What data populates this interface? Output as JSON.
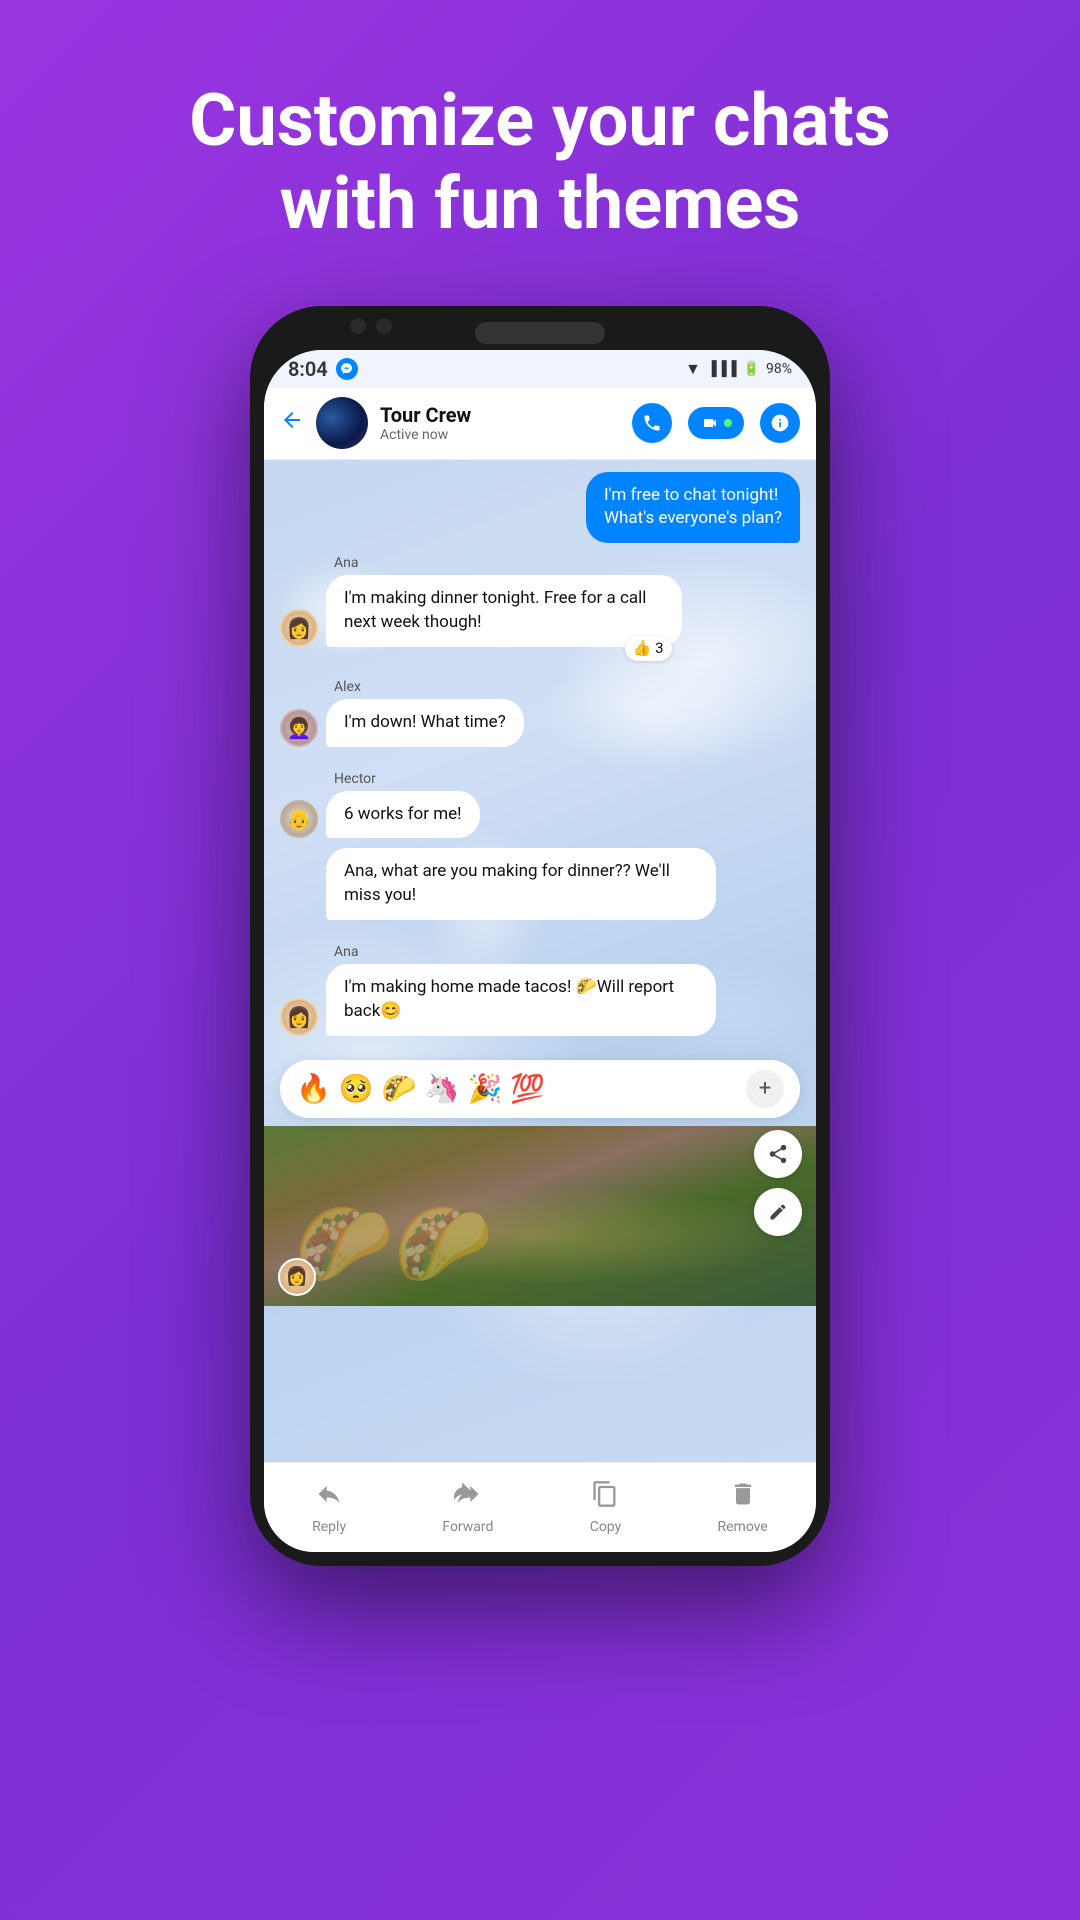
{
  "headline": {
    "line1": "Customize your chats",
    "line2": "with fun themes"
  },
  "status_bar": {
    "time": "8:04",
    "battery": "98%"
  },
  "header": {
    "group_name": "Tour Crew",
    "status": "Active now",
    "back_label": "←"
  },
  "messages": [
    {
      "id": "msg1",
      "type": "outgoing",
      "text": "I'm free to chat tonight! What's everyone's plan?"
    },
    {
      "id": "msg2",
      "type": "incoming",
      "sender": "Ana",
      "avatar": "ana",
      "text": "I'm making dinner tonight. Free for a call next week though!",
      "reaction": "👍 3"
    },
    {
      "id": "msg3",
      "type": "incoming",
      "sender": "Alex",
      "avatar": "alex",
      "text": "I'm down! What time?"
    },
    {
      "id": "msg4",
      "type": "incoming",
      "sender": "Hector",
      "avatar": "hector",
      "text": "6 works for me!"
    },
    {
      "id": "msg5",
      "type": "incoming",
      "sender": "Hector",
      "avatar": "hector",
      "text": "Ana, what are you making for dinner?? We'll miss you!"
    },
    {
      "id": "msg6",
      "type": "incoming",
      "sender": "Ana",
      "avatar": "ana",
      "text": "I'm making home made tacos! 🌮Will report back😊"
    }
  ],
  "emoji_bar": {
    "emojis": [
      "🔥",
      "🥺",
      "🌮",
      "🦄",
      "🎉",
      "💯"
    ],
    "plus_label": "+"
  },
  "bottom_actions": [
    {
      "id": "reply",
      "label": "Reply",
      "icon": "reply"
    },
    {
      "id": "forward",
      "label": "Forward",
      "icon": "forward"
    },
    {
      "id": "copy",
      "label": "Copy",
      "icon": "copy"
    },
    {
      "id": "remove",
      "label": "Remove",
      "icon": "trash"
    }
  ]
}
